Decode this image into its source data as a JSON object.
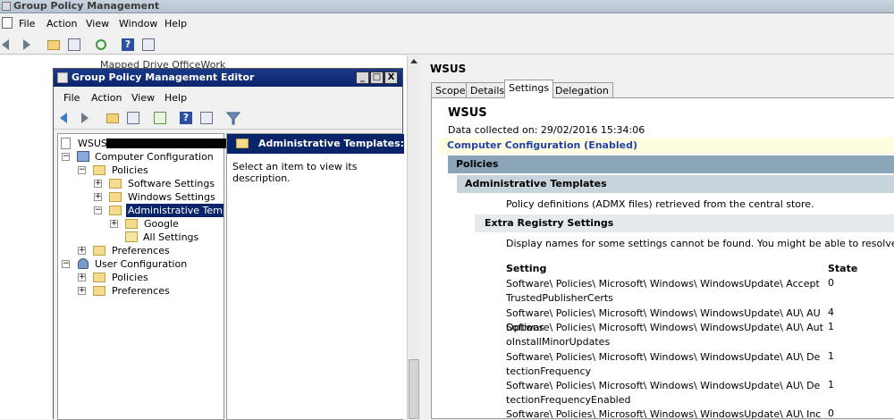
{
  "outer": {
    "title": "Group Policy Management",
    "menu": [
      "File",
      "Action",
      "View",
      "Window",
      "Help"
    ],
    "ghost_item": "Mapped Drive OfficeWork"
  },
  "editor": {
    "title": "Group Policy Management Editor",
    "menu": [
      "File",
      "Action",
      "View",
      "Help"
    ],
    "window_buttons": [
      "_",
      "□",
      "X"
    ],
    "tree": {
      "root": "WSUS [",
      "computer_config": "Computer Configuration",
      "policies": "Policies",
      "software_settings": "Software Settings",
      "windows_settings": "Windows Settings",
      "admin_templates": "Administrative Templat",
      "google": "Google",
      "all_settings": "All Settings",
      "preferences": "Preferences",
      "user_config": "User Configuration",
      "user_policies": "Policies",
      "user_preferences": "Preferences"
    },
    "detail": {
      "header": "Administrative Templates: Po",
      "description": "Select an item to view its description."
    }
  },
  "right": {
    "title": "WSUS",
    "tabs": [
      "Scope",
      "Details",
      "Settings",
      "Delegation"
    ],
    "active_tab": "Settings",
    "report": {
      "heading": "WSUS",
      "date": "Data collected on: 29/02/2016 15:34:06",
      "computer_config": "Computer Configuration (Enabled)",
      "policies": "Policies",
      "admin_templates": "Administrative Templates",
      "admx_text": "Policy definitions (ADMX files) retrieved from the central store.",
      "extra_registry": "Extra Registry Settings",
      "extra_text": "Display names for some settings cannot be found. You might be able to resolve this issue by upd",
      "col_setting": "Setting",
      "col_state": "State",
      "rows": [
        {
          "setting": "Software\\ Policies\\ Microsoft\\ Windows\\ WindowsUpdate\\ AcceptTrustedPublisherCerts",
          "state": "0"
        },
        {
          "setting": "Software\\ Policies\\ Microsoft\\ Windows\\ WindowsUpdate\\ AU\\ AUOptions",
          "state": "4"
        },
        {
          "setting": "Software\\ Policies\\ Microsoft\\ Windows\\ WindowsUpdate\\ AU\\ AutoInstallMinorUpdates",
          "state": "1"
        },
        {
          "setting": "Software\\ Policies\\ Microsoft\\ Windows\\ WindowsUpdate\\ AU\\ DetectionFrequency",
          "state": "1"
        },
        {
          "setting": "Software\\ Policies\\ Microsoft\\ Windows\\ WindowsUpdate\\ AU\\ DetectionFrequencyEnabled",
          "state": "1"
        },
        {
          "setting": "Software\\ Policies\\ Microsoft\\ Windows\\ WindowsUpdate\\ AU\\ IncludeRecom",
          "state": "0"
        }
      ]
    }
  },
  "colors": {
    "selection": "#0a246a",
    "policies_bar": "#8aa4b8",
    "config_bar": "#fefde0",
    "config_text": "#2244aa"
  }
}
